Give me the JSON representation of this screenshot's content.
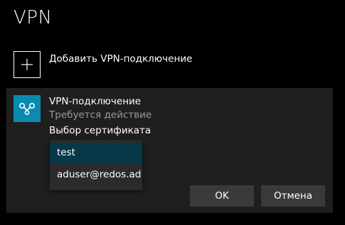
{
  "page": {
    "title": "VPN"
  },
  "add_vpn": {
    "label": "Добавить VPN-подключение",
    "icon": "plus-icon"
  },
  "connection": {
    "name": "VPN-подключение",
    "status": "Требуется действие",
    "icon": "vpn-icon",
    "icon_color": "#0a8ab1",
    "certificate_prompt": "Выбор сертификата",
    "certificates": [
      {
        "label": "test",
        "selected": true
      },
      {
        "label": "aduser@redos.ad",
        "selected": false
      }
    ]
  },
  "buttons": {
    "ok_label": "OK",
    "cancel_label": "Отмена"
  },
  "colors": {
    "background": "#000000",
    "card": "#1f1f1f",
    "selected_item": "#053848",
    "button": "#3a3a3a",
    "secondary_text": "#9a9a9a"
  }
}
